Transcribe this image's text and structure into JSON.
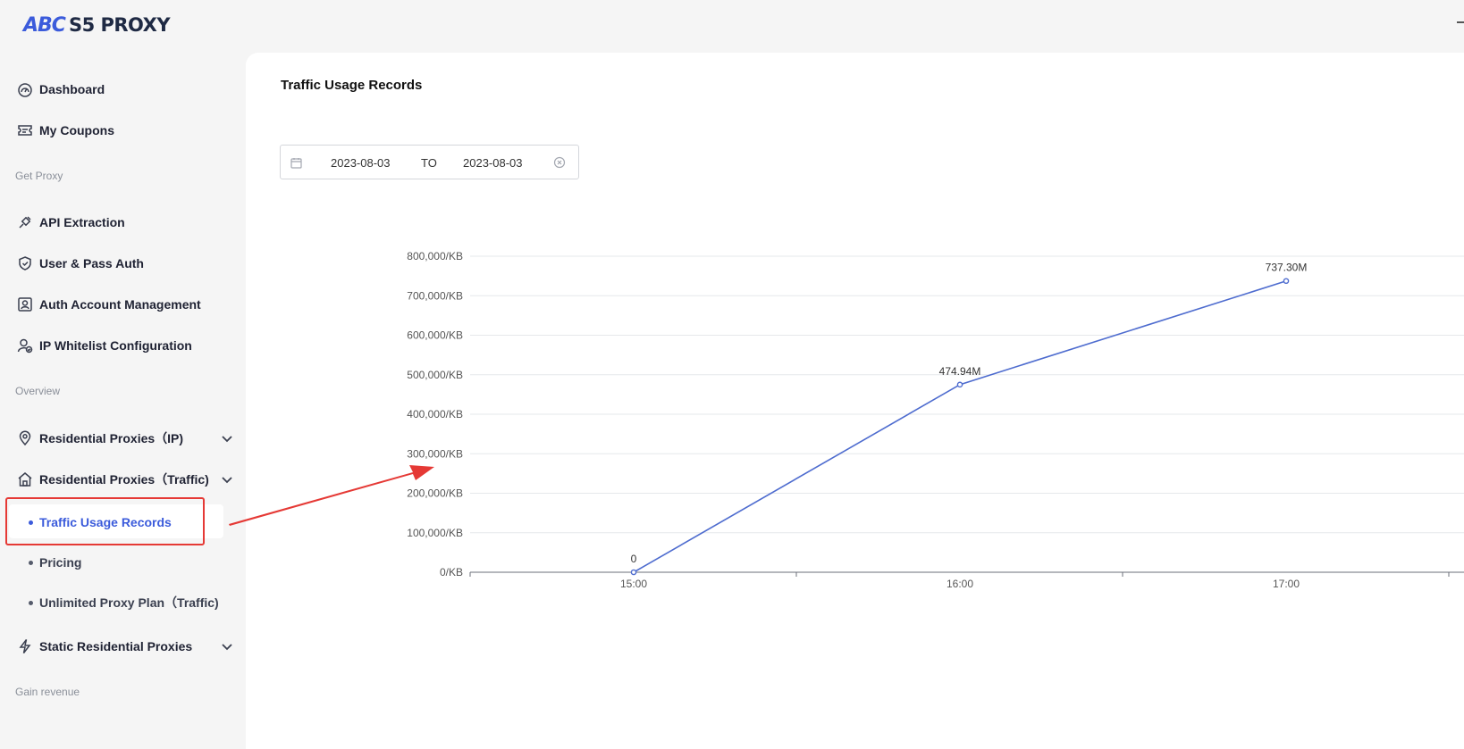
{
  "logo": {
    "mark": "ABC",
    "text": "S5 PROXY"
  },
  "sidebar": {
    "items": [
      {
        "label": "Dashboard",
        "icon": "dashboard-icon"
      },
      {
        "label": "My Coupons",
        "icon": "coupon-icon"
      }
    ],
    "sections": [
      {
        "title": "Get Proxy",
        "items": [
          {
            "label": "API Extraction",
            "icon": "plug-icon"
          },
          {
            "label": "User & Pass Auth",
            "icon": "shield-check-icon"
          },
          {
            "label": "Auth Account Management",
            "icon": "user-card-icon"
          },
          {
            "label": "IP Whitelist Configuration",
            "icon": "user-check-icon"
          }
        ]
      },
      {
        "title": "Overview",
        "items": [
          {
            "label": "Residential Proxies（IP)",
            "icon": "location-pin-icon",
            "expandable": true
          },
          {
            "label": "Residential Proxies（Traffic)",
            "icon": "house-icon",
            "expandable": true,
            "children": [
              {
                "label": "Traffic Usage Records",
                "active": true
              },
              {
                "label": "Pricing"
              },
              {
                "label": "Unlimited Proxy Plan（Traffic)"
              }
            ]
          },
          {
            "label": "Static Residential Proxies",
            "icon": "lightning-icon",
            "expandable": true
          }
        ]
      },
      {
        "title": "Gain revenue",
        "items": []
      }
    ]
  },
  "main": {
    "title": "Traffic Usage Records",
    "date_range": {
      "start": "2023-08-03",
      "separator": "TO",
      "end": "2023-08-03"
    }
  },
  "colors": {
    "accent": "#3b5bdb",
    "line": "#4e6ccf",
    "annotation": "#e53935"
  },
  "chart_data": {
    "type": "line",
    "x": [
      "15:00",
      "16:00",
      "17:00"
    ],
    "series": [
      {
        "values": [
          0,
          474940,
          737300
        ],
        "labels": [
          "0",
          "474.94M",
          "737.30M"
        ]
      }
    ],
    "yticks": [
      "0/KB",
      "100,000/KB",
      "200,000/KB",
      "300,000/KB",
      "400,000/KB",
      "500,000/KB",
      "600,000/KB",
      "700,000/KB",
      "800,000/KB"
    ],
    "ylim": [
      0,
      800000
    ],
    "grid": true
  }
}
